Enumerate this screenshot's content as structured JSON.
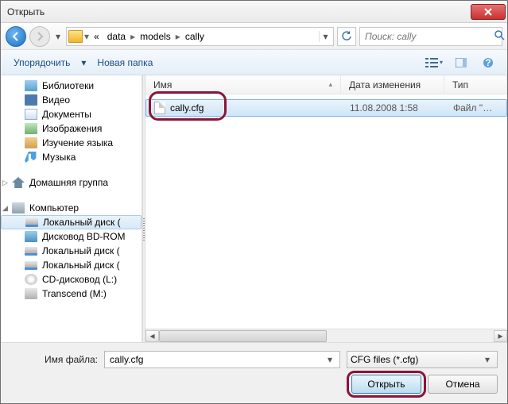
{
  "window": {
    "title": "Открыть"
  },
  "nav": {
    "breadcrumb": {
      "dblarrow": "«",
      "seg1": "data",
      "seg2": "models",
      "seg3": "cally"
    },
    "search_placeholder": "Поиск: cally"
  },
  "toolbar": {
    "organize": "Упорядочить",
    "newfolder": "Новая папка"
  },
  "sidebar": {
    "libraries": "Библиотеки",
    "videos": "Видео",
    "documents": "Документы",
    "images": "Изображения",
    "learn": "Изучение языка",
    "music": "Музыка",
    "homegroup": "Домашняя группа",
    "computer": "Компьютер",
    "localdisk1": "Локальный диск (",
    "bdrom": "Дисковод BD-ROM",
    "localdisk2": "Локальный диск (",
    "localdisk3": "Локальный диск (",
    "cddrive": "CD-дисковод (L:)",
    "transcend": "Transcend (M:)"
  },
  "columns": {
    "name": "Имя",
    "date": "Дата изменения",
    "type": "Тип"
  },
  "files": [
    {
      "name": "cally.cfg",
      "date": "11.08.2008 1:58",
      "type": "Файл \"CFG"
    }
  ],
  "footer": {
    "filename_label": "Имя файла:",
    "filename_value": "cally.cfg",
    "filter": "CFG files (*.cfg)",
    "open": "Открыть",
    "cancel": "Отмена"
  }
}
